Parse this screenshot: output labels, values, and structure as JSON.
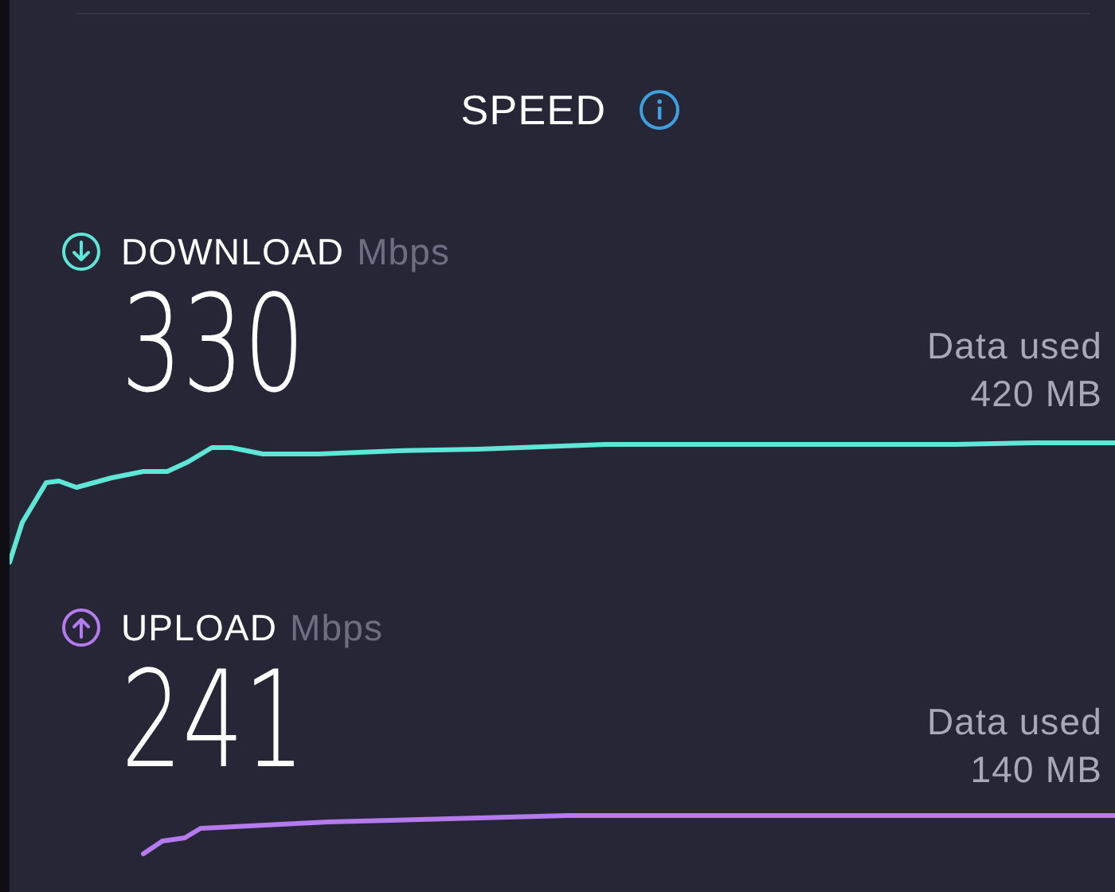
{
  "title": "SPEED",
  "results": [
    {
      "kind": "download",
      "label": "DOWNLOAD",
      "unit": "Mbps",
      "value": "330",
      "data_used_label": "Data used",
      "data_used_value": "420 MB"
    },
    {
      "kind": "upload",
      "label": "UPLOAD",
      "unit": "Mbps",
      "value": "241",
      "data_used_label": "Data used",
      "data_used_value": "140 MB"
    }
  ]
}
